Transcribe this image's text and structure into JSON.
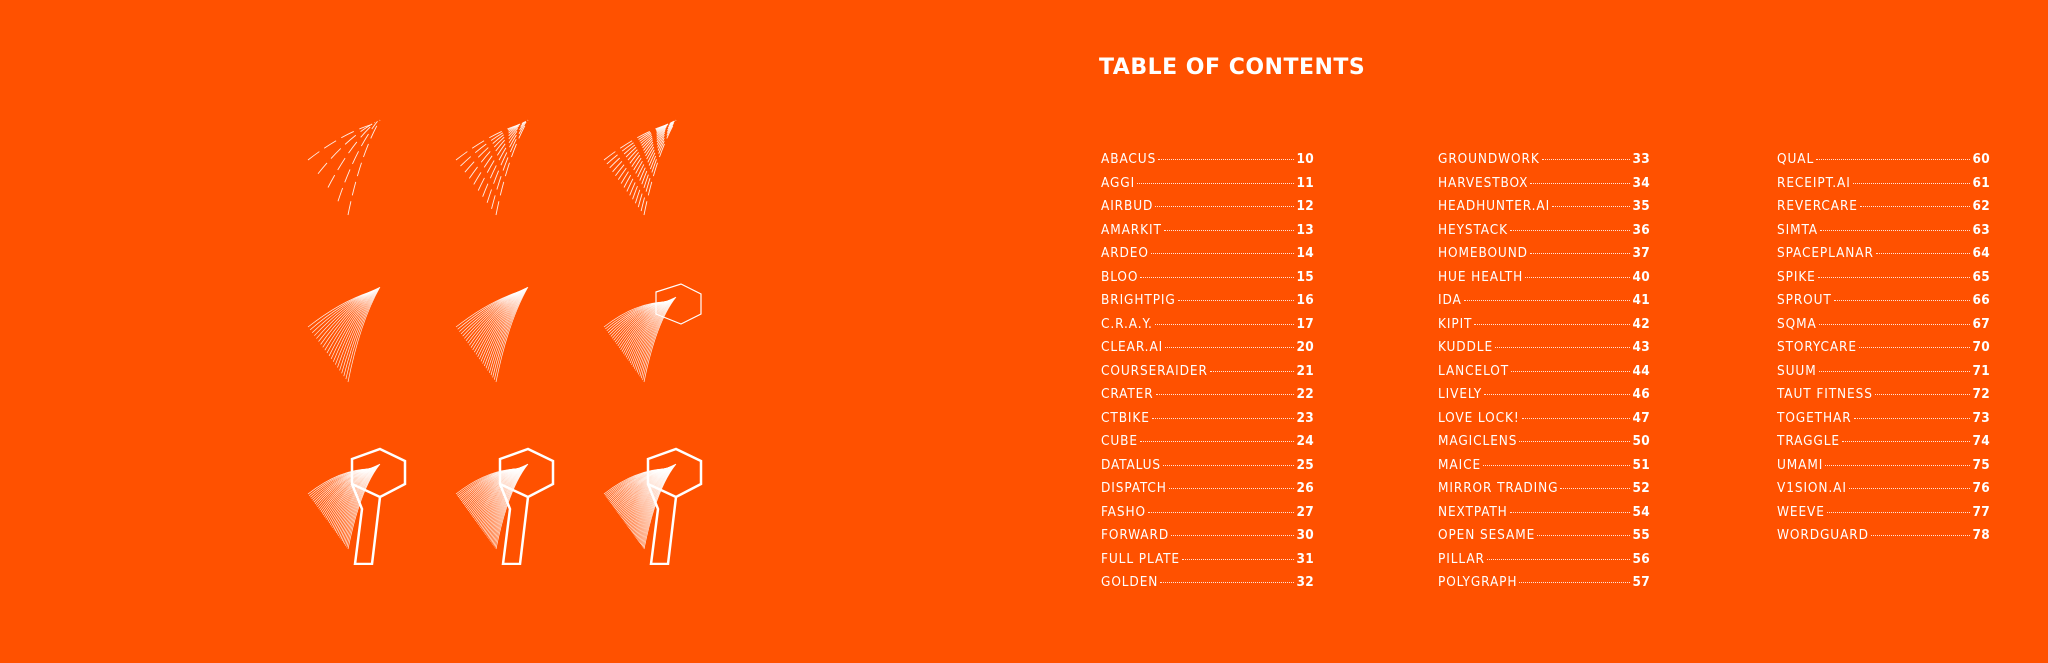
{
  "colors": {
    "background": "#FF5100",
    "text": "#FFFFFF"
  },
  "artwork": {
    "icon": "hatched-t-logo-progression-icon",
    "stages": 9
  },
  "title": "TABLE OF CONTENTS",
  "columns": [
    [
      {
        "name": "ABACUS",
        "page": "10"
      },
      {
        "name": "AGGI",
        "page": "11"
      },
      {
        "name": "AIRBUD",
        "page": "12"
      },
      {
        "name": "AMARKIT",
        "page": "13"
      },
      {
        "name": "ARDEO",
        "page": "14"
      },
      {
        "name": "BLOO",
        "page": "15"
      },
      {
        "name": "BRIGHTPIG",
        "page": "16"
      },
      {
        "name": "C.R.A.Y.",
        "page": "17"
      },
      {
        "name": "CLEAR.AI",
        "page": "20"
      },
      {
        "name": "COURSERAIDER",
        "page": "21"
      },
      {
        "name": "CRATER",
        "page": "22"
      },
      {
        "name": "CTBIKE",
        "page": "23"
      },
      {
        "name": "CUBE",
        "page": "24"
      },
      {
        "name": "DATALUS",
        "page": "25"
      },
      {
        "name": "DISPATCH",
        "page": "26"
      },
      {
        "name": "FASHO",
        "page": "27"
      },
      {
        "name": "FORWARD",
        "page": "30"
      },
      {
        "name": "FULL PLATE",
        "page": "31"
      },
      {
        "name": "GOLDEN",
        "page": "32"
      }
    ],
    [
      {
        "name": "GROUNDWORK",
        "page": "33"
      },
      {
        "name": "HARVESTBOX",
        "page": "34"
      },
      {
        "name": "HEADHUNTER.AI",
        "page": "35"
      },
      {
        "name": "HEYSTACK",
        "page": "36"
      },
      {
        "name": "HOMEBOUND",
        "page": "37"
      },
      {
        "name": "HUE HEALTH",
        "page": "40"
      },
      {
        "name": "IDA",
        "page": "41"
      },
      {
        "name": "KIPIT",
        "page": "42"
      },
      {
        "name": "KUDDLE",
        "page": "43"
      },
      {
        "name": "LANCELOT",
        "page": "44"
      },
      {
        "name": "LIVELY",
        "page": "46"
      },
      {
        "name": "LOVE LOCK!",
        "page": "47"
      },
      {
        "name": "MAGICLENS",
        "page": "50"
      },
      {
        "name": "MAICE",
        "page": "51"
      },
      {
        "name": "MIRROR TRADING",
        "page": "52"
      },
      {
        "name": "NEXTPATH",
        "page": "54"
      },
      {
        "name": "OPEN SESAME",
        "page": "55"
      },
      {
        "name": "PILLAR",
        "page": "56"
      },
      {
        "name": "POLYGRAPH",
        "page": "57"
      }
    ],
    [
      {
        "name": "QUAL",
        "page": "60"
      },
      {
        "name": "RECEIPT.AI",
        "page": "61"
      },
      {
        "name": "REVERCARE",
        "page": "62"
      },
      {
        "name": "SIMTA",
        "page": "63"
      },
      {
        "name": "SPACEPLANAR",
        "page": "64"
      },
      {
        "name": "SPIKE",
        "page": "65"
      },
      {
        "name": "SPROUT",
        "page": "66"
      },
      {
        "name": "SQMA",
        "page": "67"
      },
      {
        "name": "STORYCARE",
        "page": "70"
      },
      {
        "name": "SUUM",
        "page": "71"
      },
      {
        "name": "TAUT FITNESS",
        "page": "72"
      },
      {
        "name": "TOGETHAR",
        "page": "73"
      },
      {
        "name": "TRAGGLE",
        "page": "74"
      },
      {
        "name": "UMAMI",
        "page": "75"
      },
      {
        "name": "V1SION.AI",
        "page": "76"
      },
      {
        "name": "WEEVE",
        "page": "77"
      },
      {
        "name": "WORDGUARD",
        "page": "78"
      }
    ]
  ]
}
